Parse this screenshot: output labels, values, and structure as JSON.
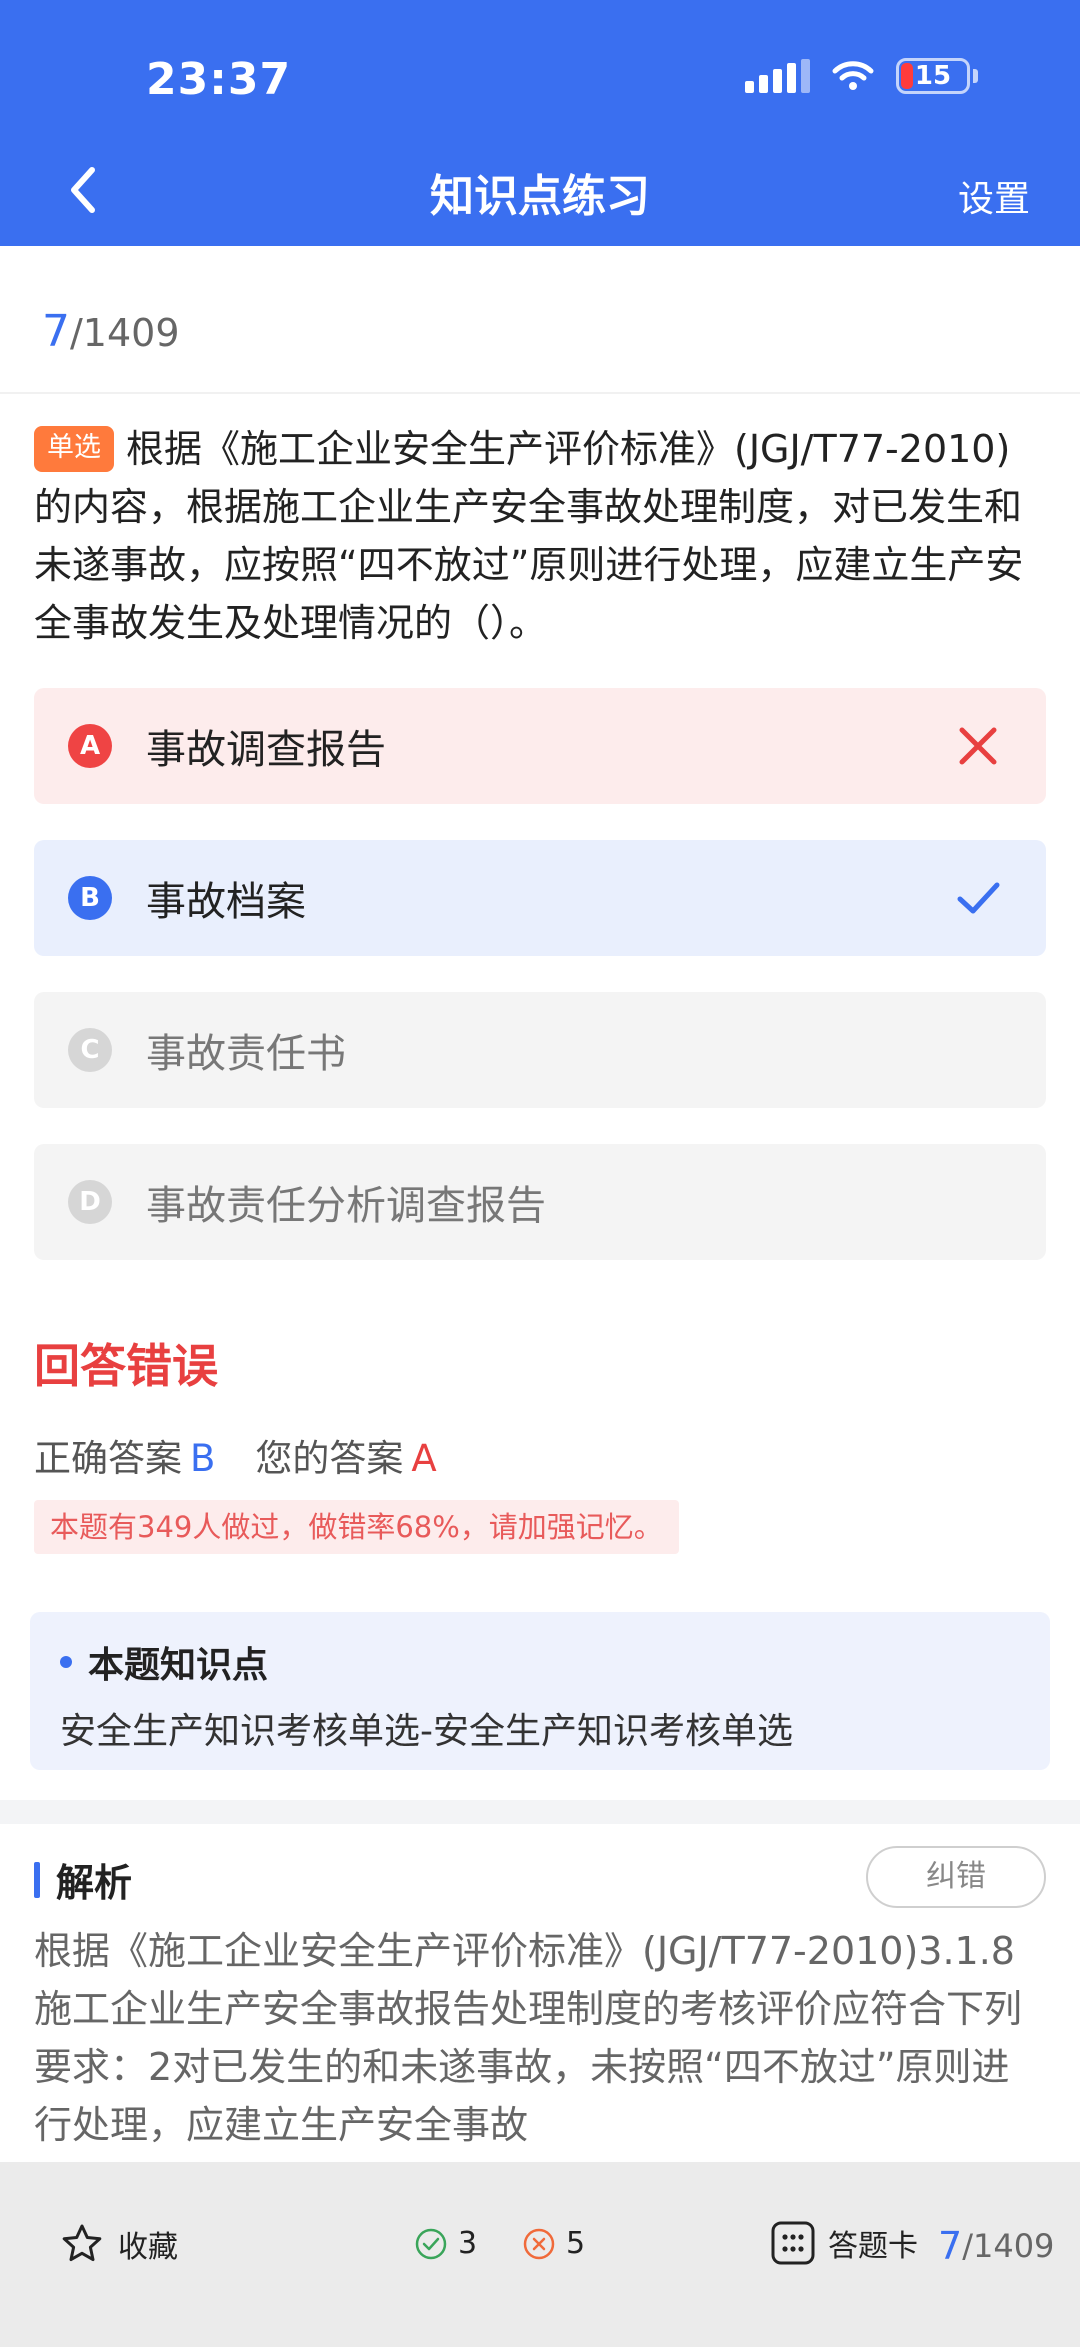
{
  "status_bar": {
    "time": "23:37",
    "battery": "15"
  },
  "nav": {
    "title": "知识点练习",
    "settings": "设置"
  },
  "progress": {
    "current": "7",
    "total": "/1409"
  },
  "question": {
    "tag": "单选",
    "text": "根据《施工企业安全生产评价标准》(JGJ/T77-2010)的内容，根据施工企业生产安全事故处理制度，对已发生和未遂事故，应按照“四不放过”原则进行处理，应建立生产安全事故发生及处理情况的（）。"
  },
  "options": [
    {
      "letter": "A",
      "text": "事故调查报告",
      "state": "wrong"
    },
    {
      "letter": "B",
      "text": "事故档案",
      "state": "correct"
    },
    {
      "letter": "C",
      "text": "事故责任书",
      "state": "none"
    },
    {
      "letter": "D",
      "text": "事故责任分析调查报告",
      "state": "none"
    }
  ],
  "result": {
    "title": "回答错误",
    "correct_label": "正确答案",
    "correct_value": "B",
    "your_label": "您的答案",
    "your_value": "A",
    "stat_note": "本题有349人做过，做错率68%，请加强记忆。"
  },
  "knowledge": {
    "title": "本题知识点",
    "text": "安全生产知识考核单选-安全生产知识考核单选"
  },
  "analysis": {
    "title": "解析",
    "correct_button": "纠错",
    "text": "根据《施工企业安全生产评价标准》(JGJ/T77-2010)3.1.8施工企业生产安全事故报告处理制度的考核评价应符合下列要求：2对已发生的和未遂事故，未按照“四不放过”原则进行处理，应建立生产安全事故"
  },
  "bottom_bar": {
    "favorite": "收藏",
    "right_count": "3",
    "wrong_count": "5",
    "answer_card": "答题卡",
    "progress_current": "7",
    "progress_total": "/1409"
  },
  "colors": {
    "primary": "#3a6ff0",
    "error": "#e84040",
    "tag": "#ff7a3c"
  },
  "icons": [
    "back-chevron-icon",
    "signal-icon",
    "wifi-icon",
    "battery-icon",
    "cross-icon",
    "check-icon",
    "star-icon",
    "check-circle-icon",
    "cross-circle-icon",
    "grid-icon"
  ]
}
